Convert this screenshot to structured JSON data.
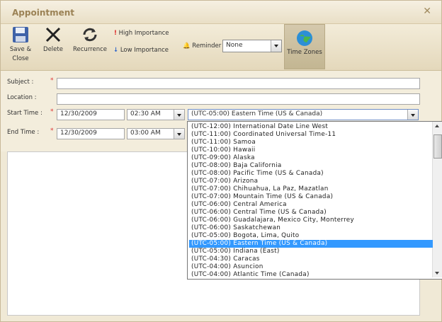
{
  "window": {
    "title": "Appointment"
  },
  "toolbar": {
    "save_close": "Save & Close",
    "delete": "Delete",
    "recurrence": "Recurrence",
    "high_importance": "High Importance",
    "low_importance": "Low Importance",
    "reminder_label": "Reminder",
    "reminder_value": "None",
    "time_zones": "Time Zones"
  },
  "form": {
    "subject_label": "Subject :",
    "location_label": "Location :",
    "start_label": "Start Time :",
    "end_label": "End Time :",
    "start_date": "12/30/2009",
    "start_time": "02:30 AM",
    "end_date": "12/30/2009",
    "end_time": "03:00 AM",
    "timezone": "(UTC-05:00) Eastern Time (US & Canada)"
  },
  "timezone_options": [
    "(UTC-12:00) International Date Line West",
    "(UTC-11:00) Coordinated Universal Time-11",
    "(UTC-11:00) Samoa",
    "(UTC-10:00) Hawaii",
    "(UTC-09:00) Alaska",
    "(UTC-08:00) Baja California",
    "(UTC-08:00) Pacific Time (US & Canada)",
    "(UTC-07:00) Arizona",
    "(UTC-07:00) Chihuahua, La Paz, Mazatlan",
    "(UTC-07:00) Mountain Time (US & Canada)",
    "(UTC-06:00) Central America",
    "(UTC-06:00) Central Time (US & Canada)",
    "(UTC-06:00) Guadalajara, Mexico City, Monterrey",
    "(UTC-06:00) Saskatchewan",
    "(UTC-05:00) Bogota, Lima, Quito",
    "(UTC-05:00) Eastern Time (US & Canada)",
    "(UTC-05:00) Indiana (East)",
    "(UTC-04:30) Caracas",
    "(UTC-04:00) Asuncion",
    "(UTC-04:00) Atlantic Time (Canada)"
  ],
  "selected_timezone_index": 15
}
